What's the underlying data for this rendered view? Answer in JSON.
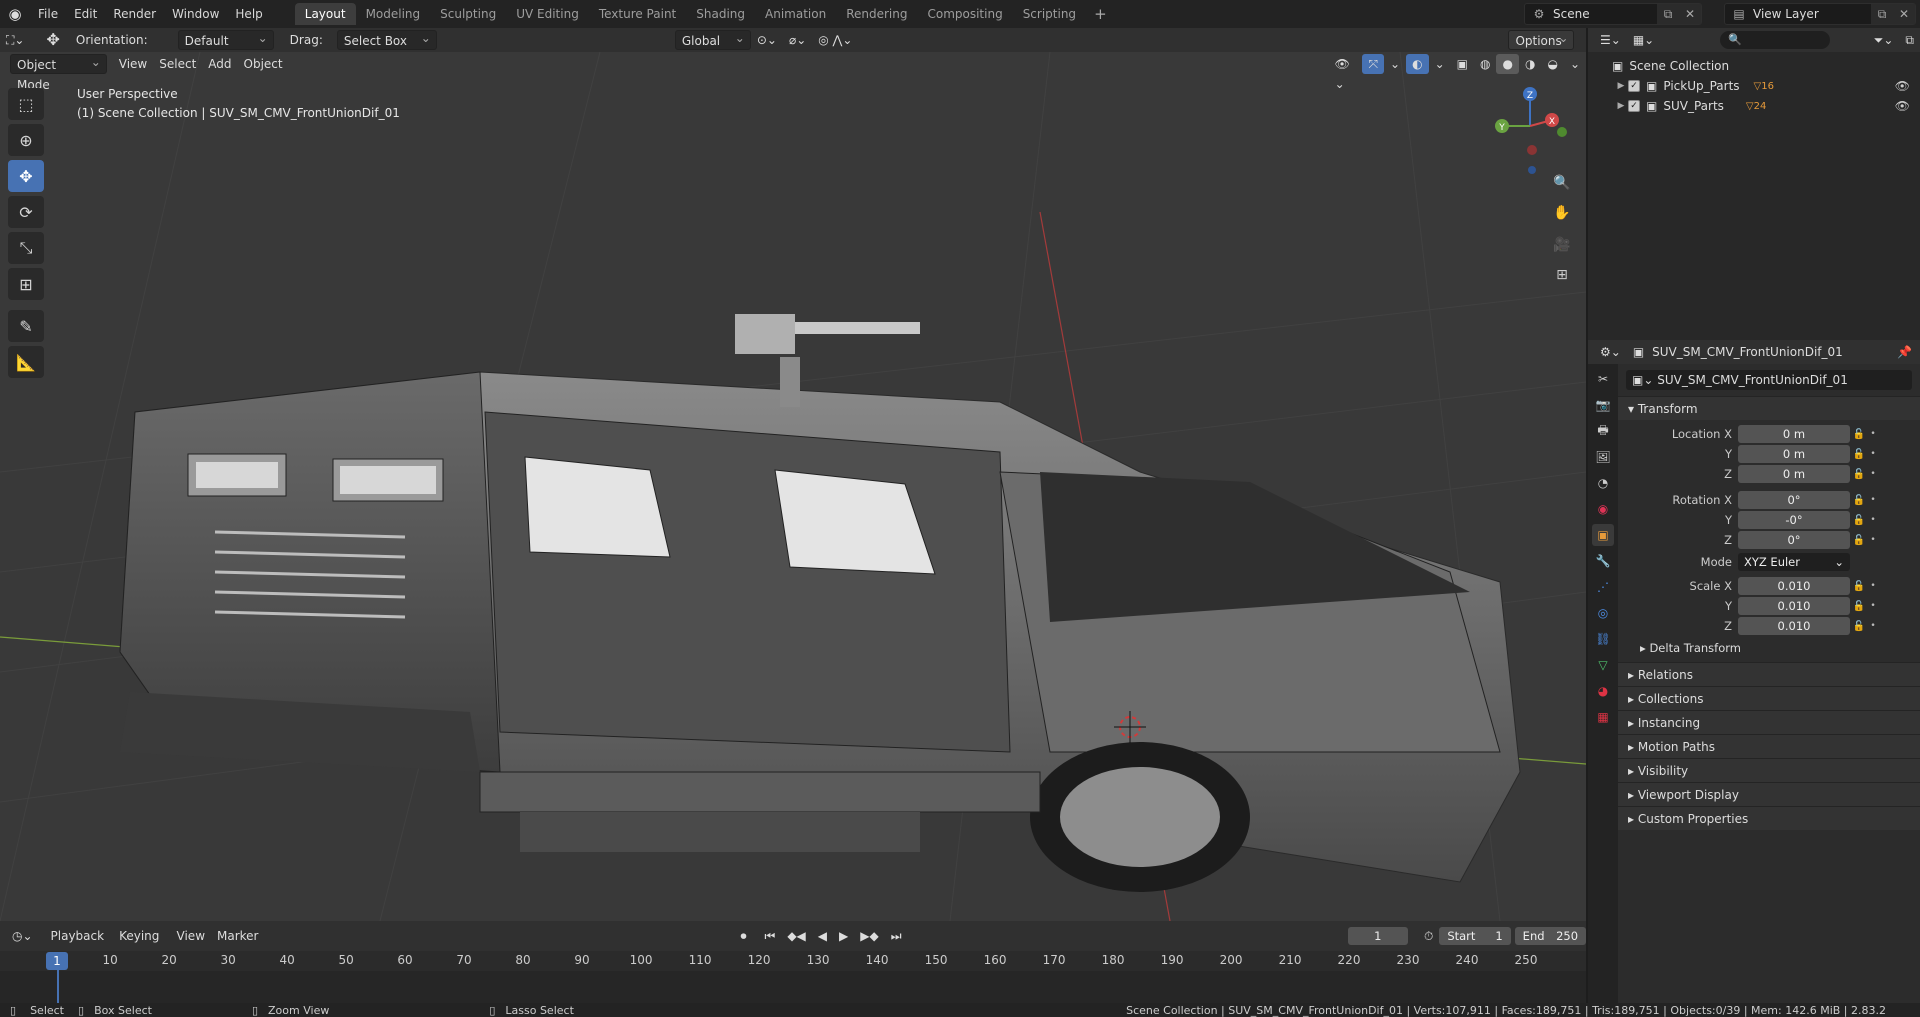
{
  "app": {
    "menu": [
      "File",
      "Edit",
      "Render",
      "Window",
      "Help"
    ],
    "workspaces": [
      "Layout",
      "Modeling",
      "Sculpting",
      "UV Editing",
      "Texture Paint",
      "Shading",
      "Animation",
      "Rendering",
      "Compositing",
      "Scripting"
    ],
    "active_workspace": "Layout",
    "scene": "Scene",
    "view_layer": "View Layer"
  },
  "viewport_header": {
    "orientation_label": "Orientation:",
    "orientation": "Default",
    "drag_label": "Drag:",
    "drag": "Select Box",
    "transform_orientation": "Global",
    "options": "Options"
  },
  "viewport_header2": {
    "mode": "Object Mode",
    "view": "View",
    "select": "Select",
    "add": "Add",
    "object": "Object"
  },
  "viewport": {
    "perspective": "User Perspective",
    "context": "(1) Scene Collection | SUV_SM_CMV_FrontUnionDif_01",
    "gizmo": {
      "z": "Z",
      "y": "Y",
      "x": "X"
    }
  },
  "outliner": {
    "root": "Scene Collection",
    "items": [
      {
        "name": "PickUp_Parts",
        "count": "16"
      },
      {
        "name": "SUV_Parts",
        "count": "24"
      }
    ]
  },
  "properties": {
    "object_name": "SUV_SM_CMV_FrontUnionDif_01",
    "data_name": "SUV_SM_CMV_FrontUnionDif_01",
    "transform_title": "Transform",
    "location": {
      "label_x": "Location X",
      "label_y": "Y",
      "label_z": "Z",
      "x": "0 m",
      "y": "0 m",
      "z": "0 m"
    },
    "rotation": {
      "label_x": "Rotation X",
      "label_y": "Y",
      "label_z": "Z",
      "x": "0°",
      "y": "-0°",
      "z": "0°"
    },
    "mode_label": "Mode",
    "mode": "XYZ Euler",
    "scale": {
      "label_x": "Scale X",
      "label_y": "Y",
      "label_z": "Z",
      "x": "0.010",
      "y": "0.010",
      "z": "0.010"
    },
    "delta": "Delta Transform",
    "panels": [
      "Relations",
      "Collections",
      "Instancing",
      "Motion Paths",
      "Visibility",
      "Viewport Display",
      "Custom Properties"
    ]
  },
  "timeline": {
    "playback": "Playback",
    "keying": "Keying",
    "view": "View",
    "marker": "Marker",
    "current_frame": "1",
    "start_label": "Start",
    "start": "1",
    "end_label": "End",
    "end": "250",
    "ticks": [
      "1",
      "10",
      "20",
      "30",
      "40",
      "50",
      "60",
      "70",
      "80",
      "90",
      "100",
      "110",
      "120",
      "130",
      "140",
      "150",
      "160",
      "170",
      "180",
      "190",
      "200",
      "210",
      "220",
      "230",
      "240",
      "250"
    ]
  },
  "statusbar": {
    "select": "Select",
    "box_select": "Box Select",
    "zoom_view": "Zoom View",
    "lasso_select": "Lasso Select",
    "stats": "Scene Collection | SUV_SM_CMV_FrontUnionDif_01 | Verts:107,911 | Faces:189,751 | Tris:189,751 | Objects:0/39 | Mem: 142.6 MiB | 2.83.2"
  }
}
